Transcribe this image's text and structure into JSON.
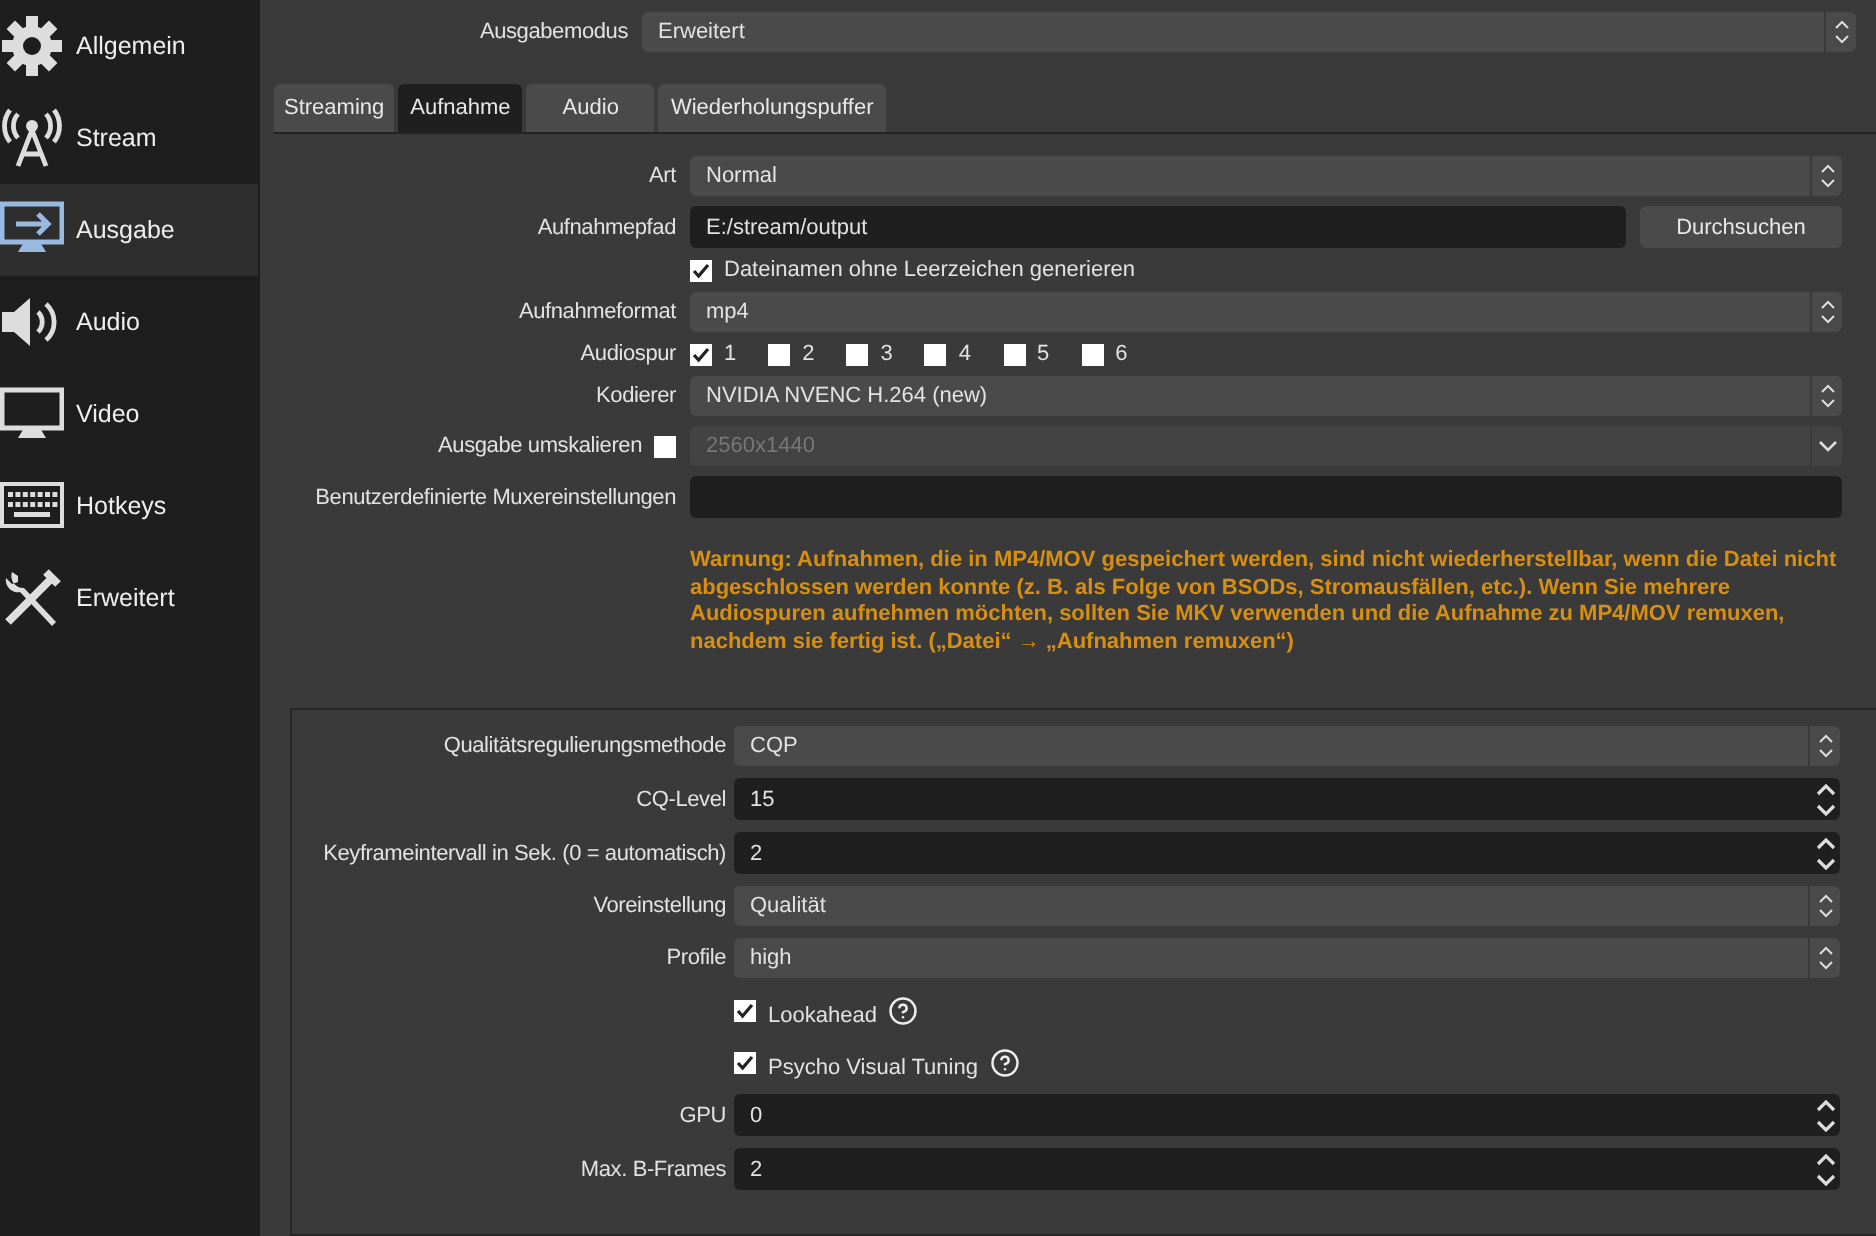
{
  "sidebar": {
    "items": [
      {
        "label": "Allgemein",
        "selected": false
      },
      {
        "label": "Stream",
        "selected": false
      },
      {
        "label": "Ausgabe",
        "selected": true
      },
      {
        "label": "Audio",
        "selected": false
      },
      {
        "label": "Video",
        "selected": false
      },
      {
        "label": "Hotkeys",
        "selected": false
      },
      {
        "label": "Erweitert",
        "selected": false
      }
    ]
  },
  "output_mode": {
    "label": "Ausgabemodus",
    "value": "Erweitert"
  },
  "tabs": [
    {
      "label": "Streaming",
      "selected": false
    },
    {
      "label": "Aufnahme",
      "selected": true
    },
    {
      "label": "Audio",
      "selected": false
    },
    {
      "label": "Wiederholungspuffer",
      "selected": false
    }
  ],
  "recording": [
    {
      "kind": "select",
      "label": "Art",
      "value": "Normal"
    },
    {
      "kind": "path",
      "label": "Aufnahmepfad",
      "value": "E:/stream/output",
      "button": "Durchsuchen"
    },
    {
      "kind": "check",
      "label": "Dateinamen ohne Leerzeichen generieren",
      "checked": true
    },
    {
      "kind": "select",
      "label": "Aufnahmeformat",
      "value": "mp4"
    },
    {
      "kind": "tracks",
      "label": "Audiospur",
      "tracks": [
        {
          "label": "1",
          "checked": true
        },
        {
          "label": "2",
          "checked": false
        },
        {
          "label": "3",
          "checked": false
        },
        {
          "label": "4",
          "checked": false
        },
        {
          "label": "5",
          "checked": false
        },
        {
          "label": "6",
          "checked": false
        }
      ]
    },
    {
      "kind": "select",
      "label": "Kodierer",
      "value": "NVIDIA NVENC H.264 (new)"
    },
    {
      "kind": "rescale",
      "label": "Ausgabe umskalieren",
      "checked": false,
      "value": "2560x1440"
    },
    {
      "kind": "text",
      "label": "Benutzerdefinierte Muxereinstellungen"
    }
  ],
  "warning": "Warnung: Aufnahmen, die in MP4/MOV gespeichert werden, sind nicht wiederherstellbar, wenn die Datei nicht abgeschlossen werden konnte (z. B. als Folge von BSODs, Stromausfällen, etc.). Wenn Sie mehrere Audiospuren aufnehmen möchten, sollten Sie MKV verwenden und die Aufnahme zu MP4/MOV remuxen, nachdem sie fertig ist. („Datei“ → „Aufnahmen remuxen“)",
  "encoder": [
    {
      "kind": "select",
      "label": "Qualitätsregulierungsmethode",
      "value": "CQP"
    },
    {
      "kind": "spin",
      "label": "CQ-Level",
      "value": "15"
    },
    {
      "kind": "spin",
      "label": "Keyframeintervall in Sek. (0 = automatisch)",
      "value": "2"
    },
    {
      "kind": "select",
      "label": "Voreinstellung",
      "value": "Qualität"
    },
    {
      "kind": "select",
      "label": "Profile",
      "value": "high"
    },
    {
      "kind": "check",
      "label": "Lookahead",
      "checked": true
    },
    {
      "kind": "check",
      "label": "Psycho Visual Tuning",
      "checked": true
    },
    {
      "kind": "spin",
      "label": "GPU",
      "value": "0"
    },
    {
      "kind": "spin",
      "label": "Max. B-Frames",
      "value": "2"
    }
  ]
}
